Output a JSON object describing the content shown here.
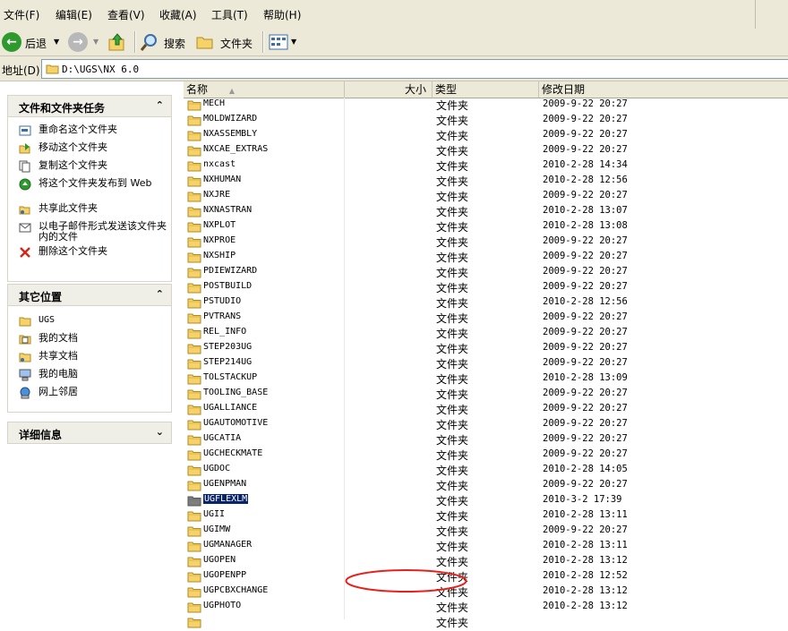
{
  "menu": [
    "文件(F)",
    "编辑(E)",
    "查看(V)",
    "收藏(A)",
    "工具(T)",
    "帮助(H)"
  ],
  "toolbar": {
    "back_label": "后退",
    "search_label": "搜索",
    "folders_label": "文件夹"
  },
  "address": {
    "label": "地址(D)",
    "path": "D:\\UGS\\NX 6.0"
  },
  "panels": {
    "tasks": {
      "title": "文件和文件夹任务",
      "items": [
        "重命名这个文件夹",
        "移动这个文件夹",
        "复制这个文件夹",
        "将这个文件夹发布到 Web",
        "共享此文件夹",
        "以电子邮件形式发送该文件夹内的文件",
        "删除这个文件夹"
      ]
    },
    "places": {
      "title": "其它位置",
      "items": [
        "UGS",
        "我的文档",
        "共享文档",
        "我的电脑",
        "网上邻居"
      ]
    },
    "details": {
      "title": "详细信息"
    }
  },
  "columns": {
    "name": "名称",
    "size": "大小",
    "type": "类型",
    "modified": "修改日期"
  },
  "files": [
    {
      "name": "MECH",
      "type": "文件夹",
      "modified": "2009-9-22 20:27"
    },
    {
      "name": "MOLDWIZARD",
      "type": "文件夹",
      "modified": "2009-9-22 20:27"
    },
    {
      "name": "NXASSEMBLY",
      "type": "文件夹",
      "modified": "2009-9-22 20:27"
    },
    {
      "name": "NXCAE_EXTRAS",
      "type": "文件夹",
      "modified": "2009-9-22 20:27"
    },
    {
      "name": "nxcast",
      "type": "文件夹",
      "modified": "2010-2-28 14:34"
    },
    {
      "name": "NXHUMAN",
      "type": "文件夹",
      "modified": "2010-2-28 12:56"
    },
    {
      "name": "NXJRE",
      "type": "文件夹",
      "modified": "2009-9-22 20:27"
    },
    {
      "name": "NXNASTRAN",
      "type": "文件夹",
      "modified": "2010-2-28 13:07"
    },
    {
      "name": "NXPLOT",
      "type": "文件夹",
      "modified": "2010-2-28 13:08"
    },
    {
      "name": "NXPROE",
      "type": "文件夹",
      "modified": "2009-9-22 20:27"
    },
    {
      "name": "NXSHIP",
      "type": "文件夹",
      "modified": "2009-9-22 20:27"
    },
    {
      "name": "PDIEWIZARD",
      "type": "文件夹",
      "modified": "2009-9-22 20:27"
    },
    {
      "name": "POSTBUILD",
      "type": "文件夹",
      "modified": "2009-9-22 20:27"
    },
    {
      "name": "PSTUDIO",
      "type": "文件夹",
      "modified": "2010-2-28 12:56"
    },
    {
      "name": "PVTRANS",
      "type": "文件夹",
      "modified": "2009-9-22 20:27"
    },
    {
      "name": "REL_INFO",
      "type": "文件夹",
      "modified": "2009-9-22 20:27"
    },
    {
      "name": "STEP203UG",
      "type": "文件夹",
      "modified": "2009-9-22 20:27"
    },
    {
      "name": "STEP214UG",
      "type": "文件夹",
      "modified": "2009-9-22 20:27"
    },
    {
      "name": "TOLSTACKUP",
      "type": "文件夹",
      "modified": "2010-2-28 13:09"
    },
    {
      "name": "TOOLING_BASE",
      "type": "文件夹",
      "modified": "2009-9-22 20:27"
    },
    {
      "name": "UGALLIANCE",
      "type": "文件夹",
      "modified": "2009-9-22 20:27"
    },
    {
      "name": "UGAUTOMOTIVE",
      "type": "文件夹",
      "modified": "2009-9-22 20:27"
    },
    {
      "name": "UGCATIA",
      "type": "文件夹",
      "modified": "2009-9-22 20:27"
    },
    {
      "name": "UGCHECKMATE",
      "type": "文件夹",
      "modified": "2009-9-22 20:27"
    },
    {
      "name": "UGDOC",
      "type": "文件夹",
      "modified": "2010-2-28 14:05"
    },
    {
      "name": "UGENPMAN",
      "type": "文件夹",
      "modified": "2009-9-22 20:27"
    },
    {
      "name": "UGFLEXLM",
      "type": "文件夹",
      "modified": "2010-3-2 17:39",
      "selected": true
    },
    {
      "name": "UGII",
      "type": "文件夹",
      "modified": "2010-2-28 13:11"
    },
    {
      "name": "UGIMW",
      "type": "文件夹",
      "modified": "2009-9-22 20:27"
    },
    {
      "name": "UGMANAGER",
      "type": "文件夹",
      "modified": "2010-2-28 13:11"
    },
    {
      "name": "UGOPEN",
      "type": "文件夹",
      "modified": "2010-2-28 13:12"
    },
    {
      "name": "UGOPENPP",
      "type": "文件夹",
      "modified": "2010-2-28 12:52"
    },
    {
      "name": "UGPCBXCHANGE",
      "type": "文件夹",
      "modified": "2010-2-28 13:12"
    },
    {
      "name": "UGPHOTO",
      "type": "文件夹",
      "modified": "2010-2-28 13:12"
    },
    {
      "name": "",
      "type": "文件夹",
      "modified": ""
    }
  ],
  "colors": {
    "selection": "#0a246a",
    "annotation": "#e8201c",
    "folder": "#f5d26a",
    "toolbar_bg": "#ece9d8"
  }
}
